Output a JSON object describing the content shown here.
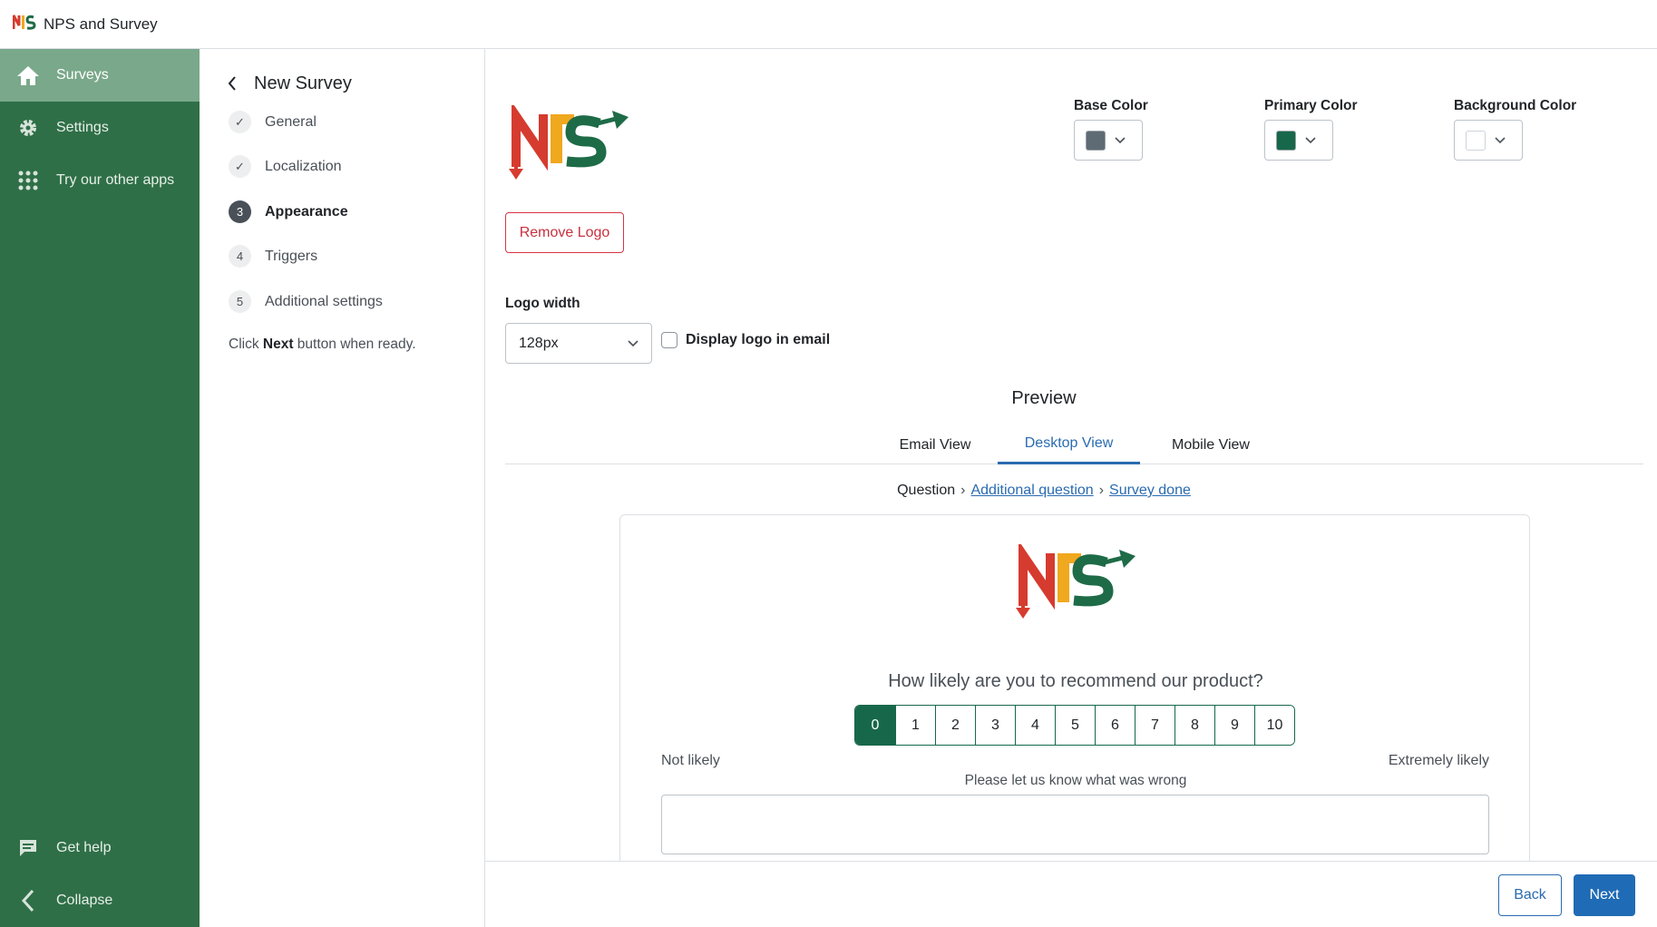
{
  "app": {
    "title": "NPS and Survey",
    "logo_icon": "nps-logo"
  },
  "sidebar": {
    "items": [
      {
        "label": "Surveys",
        "icon": "home-icon"
      },
      {
        "label": "Settings",
        "icon": "gear-icon"
      },
      {
        "label": "Try our other apps",
        "icon": "apps-grid-icon"
      }
    ],
    "bottom": [
      {
        "label": "Get help",
        "icon": "chat-icon"
      },
      {
        "label": "Collapse",
        "icon": "chevron-left-icon"
      }
    ]
  },
  "steps": {
    "title": "New Survey",
    "items": [
      {
        "marker": "✓",
        "label": "General"
      },
      {
        "marker": "✓",
        "label": "Localization"
      },
      {
        "marker": "3",
        "label": "Appearance"
      },
      {
        "marker": "4",
        "label": "Triggers"
      },
      {
        "marker": "5",
        "label": "Additional settings"
      }
    ],
    "hint_pre": "Click ",
    "hint_bold": "Next",
    "hint_post": " button when ready."
  },
  "appearance": {
    "remove_logo": "Remove Logo",
    "colors": [
      {
        "label": "Base Color",
        "value": "#5f6b74"
      },
      {
        "label": "Primary Color",
        "value": "#17684a"
      },
      {
        "label": "Background Color",
        "value": "#ffffff"
      }
    ],
    "logo_width_label": "Logo width",
    "logo_width_value": "128px",
    "display_logo_label": "Display logo in email"
  },
  "preview": {
    "title": "Preview",
    "tabs": [
      "Email View",
      "Desktop View",
      "Mobile View"
    ],
    "active_tab": "Desktop View",
    "crumbs": [
      "Question",
      "Additional question",
      "Survey done"
    ],
    "question": "How likely are you to recommend our product?",
    "scale": [
      "0",
      "1",
      "2",
      "3",
      "4",
      "5",
      "6",
      "7",
      "8",
      "9",
      "10"
    ],
    "selected": "0",
    "low_label": "Not likely",
    "high_label": "Extremely likely",
    "followup": "Please let us know what was wrong"
  },
  "footer": {
    "back": "Back",
    "next": "Next"
  }
}
